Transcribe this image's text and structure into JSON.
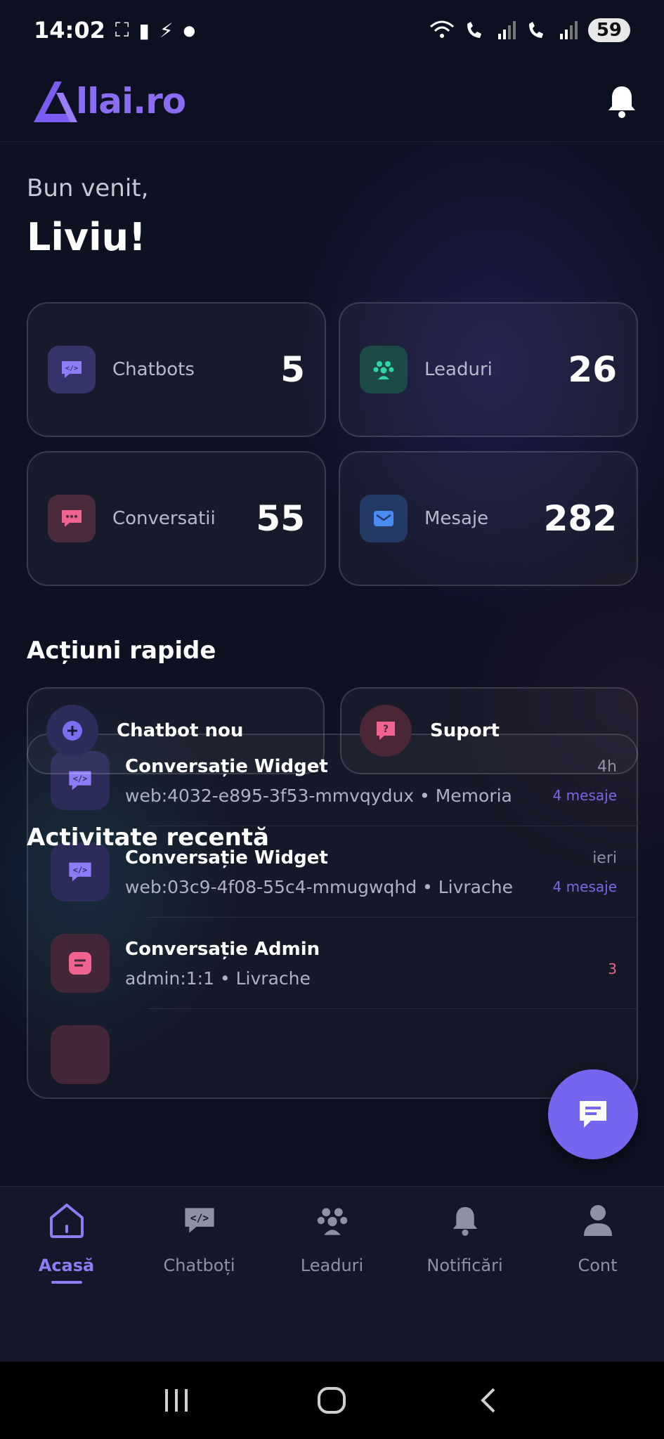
{
  "status_bar": {
    "time": "14:02",
    "battery": "59"
  },
  "header": {
    "logo_text": "llai.ro"
  },
  "greeting": {
    "line1": "Bun venit,",
    "name": "Liviu!"
  },
  "stats": [
    {
      "label": "Chatbots",
      "value": "5",
      "icon": "code-chat-icon",
      "icon_bg": "#34336a",
      "icon_color": "#8b7cf7"
    },
    {
      "label": "Leaduri",
      "value": "26",
      "icon": "people-icon",
      "icon_bg": "#1c4a48",
      "icon_color": "#2fd6a6"
    },
    {
      "label": "Conversatii",
      "value": "55",
      "icon": "chat-bubble-icon",
      "icon_bg": "#4a2a3c",
      "icon_color": "#f0628f"
    },
    {
      "label": "Mesaje",
      "value": "282",
      "icon": "mail-icon",
      "icon_bg": "#233a66",
      "icon_color": "#4a8cf2"
    }
  ],
  "quick_actions": {
    "title": "Acțiuni rapide",
    "items": [
      {
        "label": "Chatbot nou",
        "icon": "plus-icon"
      },
      {
        "label": "Suport",
        "icon": "help-icon"
      }
    ]
  },
  "recent_activity": {
    "title": "Activitate recentă",
    "items": [
      {
        "title": "Conversație Widget",
        "subtitle": "web:4032-e895-3f53-mmvqydux • Memoria",
        "time": "4h",
        "count": "4 mesaje"
      },
      {
        "title": "Conversație Widget",
        "subtitle": "web:03c9-4f08-55c4-mmugwqhd • Livrache",
        "time": "ieri",
        "count": "4 mesaje"
      },
      {
        "title": "Conversație Admin",
        "subtitle": "admin:1:1 • Livrache",
        "time": "",
        "count": "3"
      }
    ]
  },
  "bottom_nav": [
    {
      "label": "Acasă",
      "icon": "home-icon",
      "active": true
    },
    {
      "label": "Chatboți",
      "icon": "code-chat-icon",
      "active": false
    },
    {
      "label": "Leaduri",
      "icon": "people-icon",
      "active": false
    },
    {
      "label": "Notificări",
      "icon": "bell-icon",
      "active": false
    },
    {
      "label": "Cont",
      "icon": "user-icon",
      "active": false
    }
  ],
  "colors": {
    "accent": "#8b7cf7",
    "fab": "#7566f0",
    "background": "#0e1122"
  }
}
